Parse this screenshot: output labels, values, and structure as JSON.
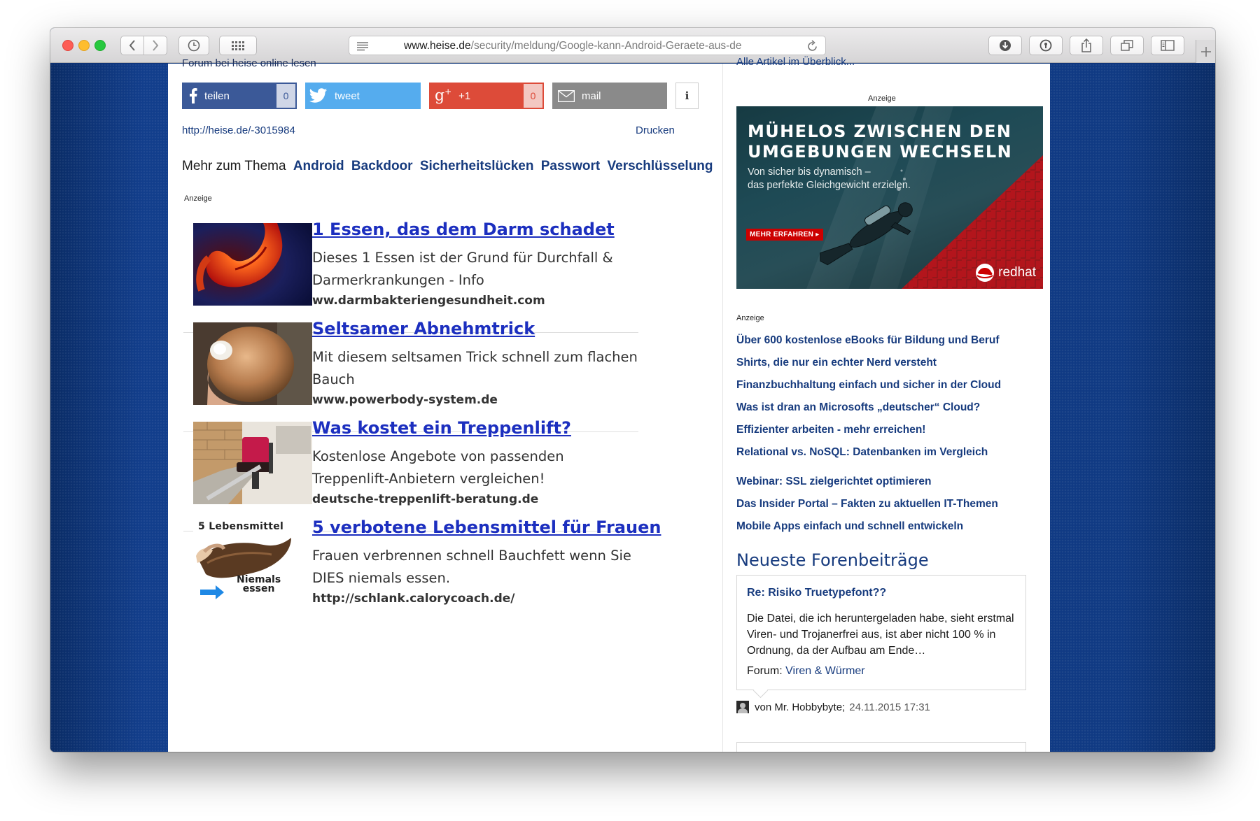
{
  "browser": {
    "url_host": "www.heise.de",
    "url_path": "/security/meldung/Google-kann-Android-Geraete-aus-de"
  },
  "article": {
    "cut_top_text": "Forum bei heise online lesen",
    "share": {
      "facebook_label": "teilen",
      "facebook_count": "0",
      "twitter_label": "tweet",
      "gplus_label": "+1",
      "gplus_count": "0",
      "mail_label": "mail",
      "info_label": "i"
    },
    "short_link": "http://heise.de/-3015984",
    "print_label": "Drucken",
    "topic_prefix": "Mehr zum Thema",
    "topic_tags": [
      "Android",
      "Backdoor",
      "Sicherheitslücken",
      "Passwort",
      "Verschlüsselung"
    ],
    "ad_label": "Anzeige",
    "ads": [
      {
        "title": "1 Essen, das dem Darm schadet",
        "desc": "Dieses 1 Essen ist der Grund für Durchfall & Darmerkrankungen - Info",
        "domain": "ww.darmbakteriengesundheit.com"
      },
      {
        "title": "Seltsamer Abnehmtrick",
        "desc": "Mit diesem seltsamen Trick schnell zum flachen Bauch",
        "domain": "www.powerbody-system.de"
      },
      {
        "title": "Was kostet ein Treppenlift?",
        "desc": "Kostenlose Angebote von passenden Treppenlift-Anbietern vergleichen!",
        "domain": "deutsche-treppenlift-beratung.de"
      },
      {
        "title": "5 verbotene Lebensmittel für Frauen",
        "desc": "Frauen verbrennen schnell Bauchfett wenn Sie DIES niemals essen.",
        "domain": "http://schlank.calorycoach.de/",
        "thumb_top": "5 Lebensmittel",
        "thumb_bottom_1": "Niemals",
        "thumb_bottom_2": "essen"
      }
    ]
  },
  "sidebar": {
    "cut_top_text": "Alle Artikel im Überblick...",
    "ad_label": "Anzeige",
    "banner": {
      "headline_1": "MÜHELOS ZWISCHEN DEN",
      "headline_2": "UMGEBUNGEN WECHSELN",
      "sub_1": "Von sicher bis dynamisch –",
      "sub_2": "das perfekte Gleichgewicht erzielen.",
      "cta": "MEHR ERFAHREN ▸",
      "brand": "redhat"
    },
    "ad2_label": "Anzeige",
    "links": [
      "Über 600 kostenlose eBooks für Bildung und Beruf",
      "Shirts, die nur ein echter Nerd versteht",
      "Finanzbuchhaltung einfach und sicher in der Cloud",
      "Was ist dran an Microsofts „deutscher“ Cloud?",
      "Effizienter arbeiten - mehr erreichen!",
      "Relational vs. NoSQL: Datenbanken im Vergleich",
      "Webinar: SSL zielgerichtet optimieren",
      "Das Insider Portal – Fakten zu aktuellen IT-Themen",
      "Mobile Apps einfach und schnell entwickeln"
    ],
    "forum": {
      "heading": "Neueste Forenbeiträge",
      "post_title": "Re: Risiko Truetypefont??",
      "post_text": "Die Datei, die ich heruntergeladen habe, sieht erstmal Viren- und Trojanerfrei aus, ist aber nicht 100 % in Ordnung, da der Aufbau am Ende…",
      "forum_prefix": "Forum:",
      "forum_name": "Viren & Würmer",
      "author": "von Mr. Hobbybyte;",
      "date": "24.11.2015 17:31"
    }
  },
  "colors": {
    "heise_blue": "#173b7e",
    "ad_link_blue": "#1c2fbf",
    "facebook": "#3b5998",
    "twitter": "#55acee",
    "gplus": "#dd4b39",
    "redhat_red": "#cc0000"
  }
}
